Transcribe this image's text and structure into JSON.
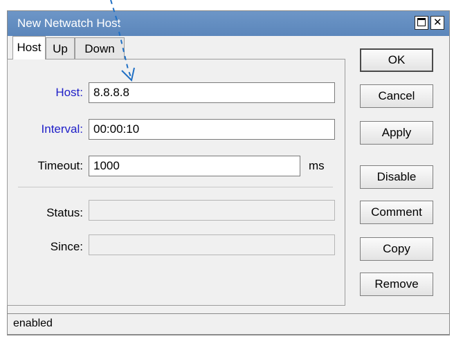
{
  "window": {
    "title": "New Netwatch Host",
    "maximize_icon": "maximize-icon",
    "close_icon": "close-icon"
  },
  "tabs": [
    {
      "label": "Host",
      "active": true
    },
    {
      "label": "Up",
      "active": false
    },
    {
      "label": "Down",
      "active": false
    }
  ],
  "form": {
    "host_label": "Host:",
    "host_value": "8.8.8.8",
    "interval_label": "Interval:",
    "interval_value": "00:00:10",
    "timeout_label": "Timeout:",
    "timeout_value": "1000",
    "timeout_unit": "ms",
    "status_label": "Status:",
    "status_value": "",
    "since_label": "Since:",
    "since_value": ""
  },
  "buttons": {
    "ok": "OK",
    "cancel": "Cancel",
    "apply": "Apply",
    "disable": "Disable",
    "comment": "Comment",
    "copy": "Copy",
    "remove": "Remove"
  },
  "statusbar": {
    "text": "enabled"
  },
  "colors": {
    "titlebar": "#5b86bb",
    "label_blue": "#2020c8",
    "annotation_arrow": "#1f6fc4"
  }
}
